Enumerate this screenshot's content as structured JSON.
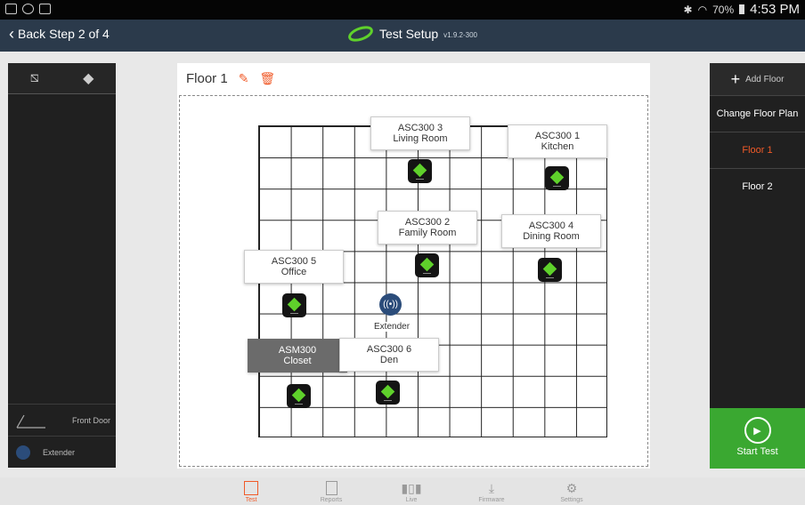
{
  "statusbar": {
    "battery": "70%",
    "time": "4:53 PM"
  },
  "topbar": {
    "back_label": "Back",
    "step": "Step 2 of 4",
    "title": "Test Setup",
    "version": "v1.9.2-300"
  },
  "floor": {
    "name": "Floor 1"
  },
  "devices": [
    {
      "name": "ASC300 3",
      "room": "Living Room"
    },
    {
      "name": "ASC300 1",
      "room": "Kitchen"
    },
    {
      "name": "ASC300 2",
      "room": "Family Room"
    },
    {
      "name": "ASC300 4",
      "room": "Dining Room"
    },
    {
      "name": "ASC300 5",
      "room": "Office"
    },
    {
      "name": "ASM300",
      "room": "Closet"
    },
    {
      "name": "ASC300 6",
      "room": "Den"
    }
  ],
  "extender_label": "Extender",
  "leftpanel": {
    "front_door": "Front Door",
    "extender": "Extender"
  },
  "rightpanel": {
    "add_floor": "Add Floor",
    "change_plan": "Change Floor Plan",
    "floors": [
      "Floor 1",
      "Floor 2"
    ]
  },
  "start_test": "Start Test",
  "colors": {
    "accent": "#f05a28",
    "green": "#3aa831",
    "node_green": "#5fd12b",
    "topbar": "#2b3a4b"
  },
  "bottom_nav": [
    {
      "label": "Test",
      "icon": "test-icon"
    },
    {
      "label": "Reports",
      "icon": "reports-icon"
    },
    {
      "label": "Live",
      "icon": "live-icon"
    },
    {
      "label": "Firmware",
      "icon": "firmware-icon"
    },
    {
      "label": "Settings",
      "icon": "settings-icon"
    }
  ]
}
